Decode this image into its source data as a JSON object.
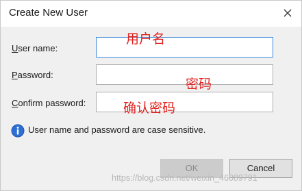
{
  "window": {
    "title": "Create New User"
  },
  "form": {
    "username_label_underline": "U",
    "username_label_rest": "ser name:",
    "password_label_underline": "P",
    "password_label_rest": "assword:",
    "confirm_label_underline": "C",
    "confirm_label_rest": "onfirm password:",
    "username_value": "",
    "password_value": "",
    "confirm_value": ""
  },
  "annotations": {
    "username": "用户名",
    "password": "密码",
    "confirm": "确认密码"
  },
  "info": {
    "text": "User name and password are case sensitive."
  },
  "buttons": {
    "ok": "OK",
    "cancel": "Cancel"
  },
  "watermark": "https://blog.csdn.net/weixin_46089791",
  "colors": {
    "annotation": "#e0221e",
    "focus_border": "#3c8ad9",
    "info_icon": "#2e6fd6"
  }
}
